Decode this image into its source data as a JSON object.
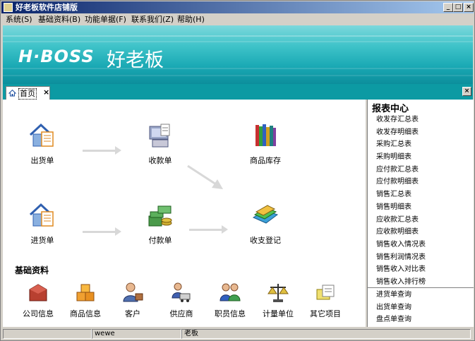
{
  "window": {
    "title": "好老板软件店铺版",
    "buttons": {
      "minimize": "_",
      "maximize": "□",
      "close": "×"
    }
  },
  "menu": [
    "系统(S)",
    "基础资料(B)",
    "功能单据(F)",
    "联系我们(Z)",
    "帮助(H)"
  ],
  "banner": {
    "logo_en": "H·BOSS",
    "logo_cn": "好老板"
  },
  "tabs": [
    {
      "label": "首页",
      "close": "×",
      "icon": "home-icon"
    }
  ],
  "flow": {
    "ship_order": {
      "label": "出货单",
      "icon": "house-document-icon"
    },
    "receipt": {
      "label": "收款单",
      "icon": "computer-receipt-icon"
    },
    "inventory": {
      "label": "商品库存",
      "icon": "books-stack-icon"
    },
    "purchase_order": {
      "label": "进货单",
      "icon": "house-document-icon"
    },
    "payment": {
      "label": "付款单",
      "icon": "money-stack-icon"
    },
    "ledger": {
      "label": "收支登记",
      "icon": "folders-icon"
    }
  },
  "basic": {
    "title": "基础资料",
    "items": [
      {
        "label": "公司信息",
        "icon": "building-icon"
      },
      {
        "label": "商品信息",
        "icon": "boxes-icon"
      },
      {
        "label": "客户",
        "icon": "customer-icon"
      },
      {
        "label": "供应商",
        "icon": "supplier-truck-icon"
      },
      {
        "label": "职员信息",
        "icon": "staff-icon"
      },
      {
        "label": "计量单位",
        "icon": "scale-icon"
      },
      {
        "label": "其它项目",
        "icon": "misc-items-icon"
      }
    ]
  },
  "reports": {
    "title": "报表中心",
    "items": [
      "收发存汇总表",
      "收发存明细表",
      "采购汇总表",
      "采购明细表",
      "应付款汇总表",
      "应付款明细表",
      "销售汇总表",
      "销售明细表",
      "应收款汇总表",
      "应收款明细表",
      "销售收入情况表",
      "销售利润情况表",
      "销售收入对比表",
      "销售收入排行榜"
    ],
    "queries": [
      "进货单查询",
      "出货单查询",
      "盘点单查询"
    ]
  },
  "status": {
    "user": "wewe",
    "role": "老板"
  }
}
